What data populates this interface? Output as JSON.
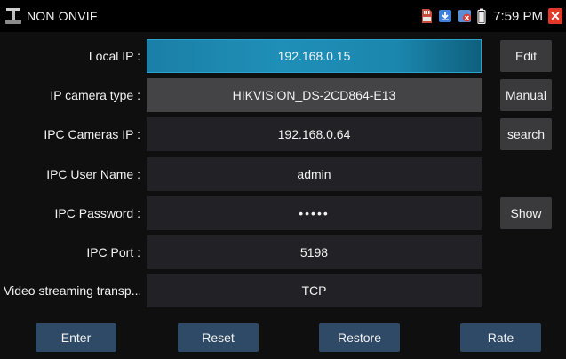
{
  "statusbar": {
    "title": "NON ONVIF",
    "time": "7:59 PM",
    "icons": [
      "tools-icon",
      "sd-card-icon",
      "download-icon",
      "network-error-icon",
      "battery-icon",
      "close-icon"
    ],
    "close_glyph": "✕"
  },
  "form": {
    "rows": [
      {
        "label": "Local IP :",
        "value": "192.168.0.15",
        "button": "Edit"
      },
      {
        "label": "IP camera type :",
        "value": "HIKVISION_DS-2CD864-E13",
        "button": "Manual"
      },
      {
        "label": "IPC Cameras IP :",
        "value": "192.168.0.64",
        "button": "search"
      },
      {
        "label": "IPC User Name :",
        "value": "admin"
      },
      {
        "label": "IPC Password :",
        "value": "•••••",
        "button": "Show"
      },
      {
        "label": "IPC Port :",
        "value": "5198"
      },
      {
        "label": "Video streaming transp...",
        "value": "TCP"
      }
    ]
  },
  "footer": {
    "enter": "Enter",
    "reset": "Reset",
    "restore": "Restore",
    "rate": "Rate"
  },
  "colors": {
    "active_field": "#1f8fb8",
    "field": "#222226",
    "button": "#3a3a3c",
    "footer_button": "#2e4a66",
    "close": "#e2382a"
  }
}
